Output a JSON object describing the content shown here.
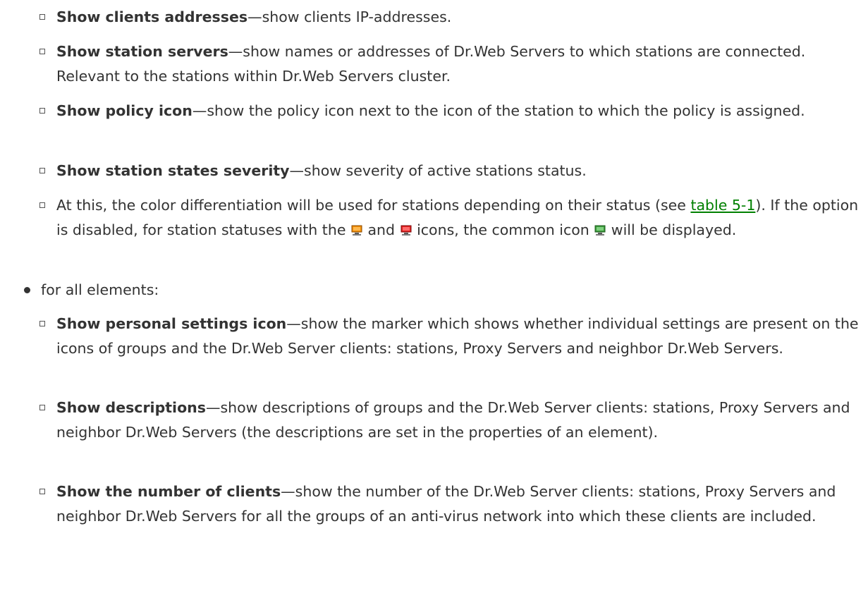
{
  "items": [
    {
      "term": "Show clients addresses",
      "desc": "—show clients IP-addresses."
    },
    {
      "term": "Show station servers",
      "desc": "—show names or addresses of Dr.Web Servers to which stations are connected. Relevant to the stations within Dr.Web Servers cluster."
    },
    {
      "term": "Show policy icon",
      "desc": "—show the policy icon next to the icon of the station to which the policy is assigned."
    },
    {
      "term": "Show station states severity",
      "desc": "—show severity of active stations status."
    }
  ],
  "color_note": {
    "part1": "At this, the color differentiation will be used for stations depending on their status (see ",
    "link": "table 5-1",
    "part2": "). If the option is disabled, for station statuses with the ",
    "part3": " and ",
    "part4": " icons, the common icon ",
    "part5": " will be displayed.",
    "icons": {
      "orange": "station-orange-icon",
      "red": "station-red-icon",
      "green": "station-green-icon"
    }
  },
  "all_elements": {
    "label": "for all elements:"
  },
  "items2": [
    {
      "term": "Show personal settings icon",
      "desc": "—show the marker which shows whether individual settings are present on the icons of groups and the Dr.Web Server clients: stations, Proxy Servers and neighbor Dr.Web Servers."
    },
    {
      "term": "Show descriptions",
      "desc": "—show descriptions of groups and the Dr.Web Server clients: stations, Proxy Servers and neighbor Dr.Web Servers (the descriptions are set in the properties of an element)."
    },
    {
      "term": "Show the number of clients",
      "desc": "—show the number of the Dr.Web Server clients: stations, Proxy Servers and neighbor Dr.Web Servers for all the groups of an anti-virus network into which these clients are included."
    }
  ],
  "colors": {
    "link": "#008000",
    "text": "#333333",
    "station_orange": "#f08c00",
    "station_red": "#e02020",
    "station_green": "#3a9a3a"
  }
}
